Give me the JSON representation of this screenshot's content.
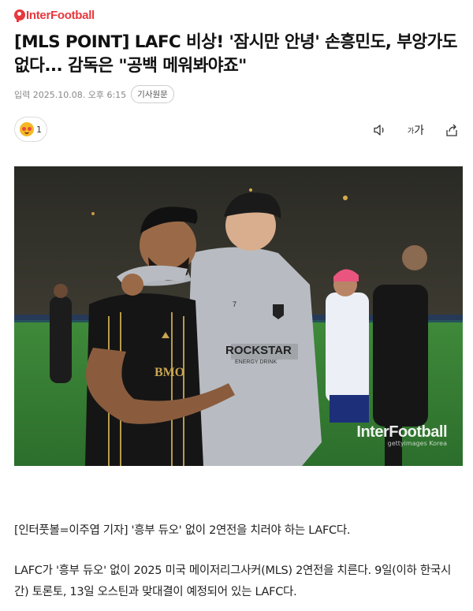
{
  "brand": {
    "name": "InterFootball"
  },
  "article": {
    "headline": "[MLS POINT] LAFC 비상! '잠시만 안녕' 손흥민도, 부앙가도 없다... 감독은 \"공백 메워봐야죠\"",
    "date": "입력 2025.10.08. 오후 6:15",
    "original_button": "기사원문",
    "reaction_count": "1",
    "font_size_label_small": "가",
    "font_size_label": "가",
    "photo": {
      "watermark": "InterFootball",
      "watermark_sub": "gettyimages Korea",
      "jersey_sponsor": "ROCKSTAR",
      "jersey_sponsor_sub": "ENERGY DRINK",
      "jersey_sponsor_left": "BMO",
      "jersey_number": "7"
    },
    "paragraph1": "[인터풋볼=이주엽 기자] '흥부 듀오' 없이 2연전을 치러야 하는 LAFC다.",
    "paragraph2": "LAFC가 '흥부 듀오' 없이 2025 미국 메이저리그사커(MLS) 2연전을 치른다. 9일(이하 한국시간) 토론토, 13일 오스틴과 맞대결이 예정되어 있는 LAFC다."
  },
  "icons": {
    "audio": "speaker-icon",
    "font": "font-size-icon",
    "share": "share-icon",
    "reaction": "reaction-emoji-icon"
  },
  "colors": {
    "brand": "#e8383d"
  }
}
